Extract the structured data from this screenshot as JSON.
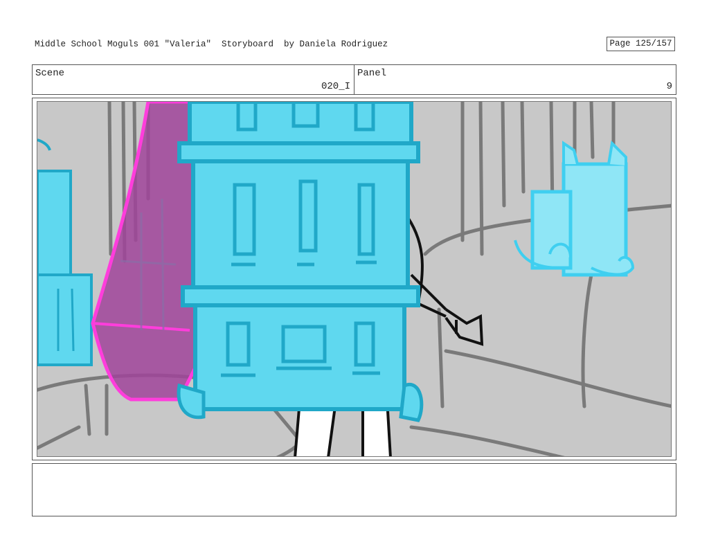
{
  "header": {
    "title": "Middle School Moguls 001 \"Valeria\"  Storyboard  by Daniela Rodriguez",
    "page": "Page 125/157"
  },
  "scene": {
    "label": "Scene",
    "value": "020_I"
  },
  "panel": {
    "label": "Panel",
    "value": "9"
  },
  "notes": {
    "text": ""
  },
  "colors": {
    "background_sketch": "#c8c8c8",
    "building_cyan": "#5fd8ef",
    "building_outline": "#20a8c8",
    "curtain_magenta": "#ff3ddc",
    "curtain_fill": "#a0449a"
  }
}
